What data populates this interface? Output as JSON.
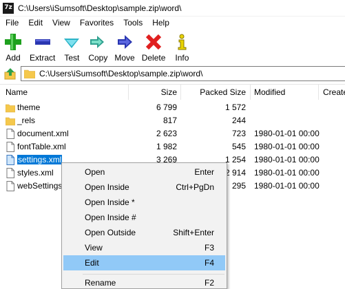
{
  "window": {
    "app_icon_text": "7z",
    "title": "C:\\Users\\iSumsoft\\Desktop\\sample.zip\\word\\"
  },
  "menu": [
    "File",
    "Edit",
    "View",
    "Favorites",
    "Tools",
    "Help"
  ],
  "toolbar": [
    {
      "label": "Add",
      "icon": "plus-icon",
      "color": "#1ea01e"
    },
    {
      "label": "Extract",
      "icon": "minus-icon",
      "color": "#2a36b1"
    },
    {
      "label": "Test",
      "icon": "check-arrow-icon",
      "color": "#2bb3c7"
    },
    {
      "label": "Copy",
      "icon": "double-arrow-icon",
      "color": "#2fa08f"
    },
    {
      "label": "Move",
      "icon": "right-arrow-icon",
      "color": "#2a36b1"
    },
    {
      "label": "Delete",
      "icon": "x-icon",
      "color": "#e01f1f"
    },
    {
      "label": "Info",
      "icon": "info-icon",
      "color": "#e8d300"
    }
  ],
  "address": {
    "path": "C:\\Users\\iSumsoft\\Desktop\\sample.zip\\word\\"
  },
  "columns": {
    "name": "Name",
    "size": "Size",
    "packed": "Packed Size",
    "modified": "Modified",
    "created": "Create"
  },
  "files": [
    {
      "name": "theme",
      "type": "folder",
      "size": "6 799",
      "packed": "1 572",
      "modified": ""
    },
    {
      "name": "_rels",
      "type": "folder",
      "size": "817",
      "packed": "244",
      "modified": ""
    },
    {
      "name": "document.xml",
      "type": "file",
      "size": "2 623",
      "packed": "723",
      "modified": "1980-01-01 00:00"
    },
    {
      "name": "fontTable.xml",
      "type": "file",
      "size": "1 982",
      "packed": "545",
      "modified": "1980-01-01 00:00"
    },
    {
      "name": "settings.xml",
      "type": "file",
      "size": "3 269",
      "packed": "1 254",
      "modified": "1980-01-01 00:00",
      "selected": true
    },
    {
      "name": "styles.xml",
      "type": "file",
      "size": "",
      "packed": "2 914",
      "modified": "1980-01-01 00:00"
    },
    {
      "name": "webSettings",
      "type": "file",
      "size": "",
      "packed": "295",
      "modified": "1980-01-01 00:00"
    }
  ],
  "context_menu": [
    {
      "label": "Open",
      "shortcut": "Enter"
    },
    {
      "label": "Open Inside",
      "shortcut": "Ctrl+PgDn"
    },
    {
      "label": "Open Inside *",
      "shortcut": ""
    },
    {
      "label": "Open Inside #",
      "shortcut": ""
    },
    {
      "label": "Open Outside",
      "shortcut": "Shift+Enter"
    },
    {
      "label": "View",
      "shortcut": "F3"
    },
    {
      "label": "Edit",
      "shortcut": "F4",
      "highlighted": true
    },
    {
      "label": "Rename",
      "shortcut": "F2"
    }
  ],
  "colors": {
    "selection": "#0078d7",
    "menu_highlight": "#91c9f7",
    "folder": "#f5c84c"
  }
}
